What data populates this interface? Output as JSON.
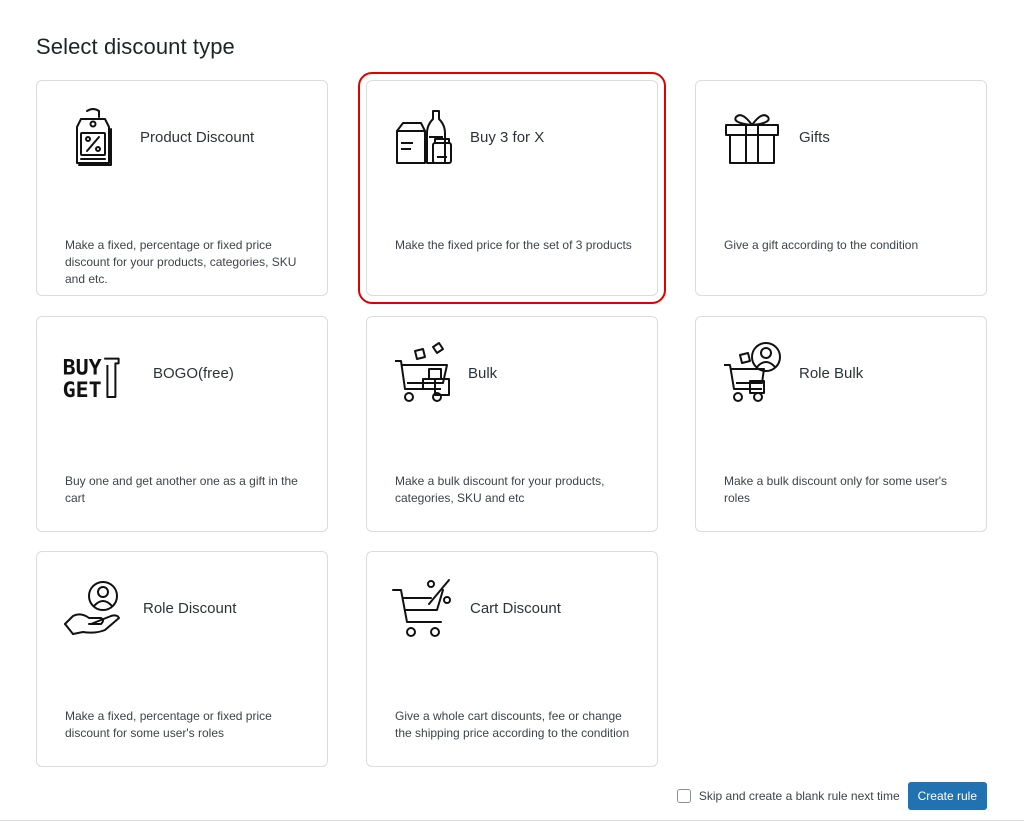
{
  "page": {
    "title": "Select discount type"
  },
  "cards": [
    {
      "name": "Product Discount",
      "description": "Make a fixed, percentage or fixed price discount for your products, categories, SKU and etc.",
      "icon": "price-tag-percent-icon"
    },
    {
      "name": "Buy 3 for X",
      "description": "Make the fixed price for the set of 3 products",
      "icon": "grocery-bundle-icon"
    },
    {
      "name": "Gifts",
      "description": "Give a gift according to the condition",
      "icon": "gift-box-icon"
    },
    {
      "name": "BOGO(free)",
      "description": "Buy one and get another one as a gift in the cart",
      "icon": "buy-get-1-icon",
      "icon_text": [
        "BUY",
        "GET"
      ]
    },
    {
      "name": "Bulk",
      "description": "Make a bulk discount for your products, categories, SKU and etc",
      "icon": "cart-boxes-icon"
    },
    {
      "name": "Role Bulk",
      "description": "Make a bulk discount only for some user's roles",
      "icon": "cart-user-icon"
    },
    {
      "name": "Role Discount",
      "description": "Make a fixed, percentage or fixed price discount for some user's roles",
      "icon": "hand-user-icon"
    },
    {
      "name": "Cart Discount",
      "description": "Give a whole cart discounts, fee or change the shipping price according to the condition",
      "icon": "cart-percent-icon"
    }
  ],
  "footer": {
    "skip_label": "Skip and create a blank rule next time",
    "skip_checked": false,
    "create_button": "Create rule"
  },
  "colors": {
    "highlight": "#e00000",
    "button": "#2271b1",
    "border": "#dcdcde"
  }
}
